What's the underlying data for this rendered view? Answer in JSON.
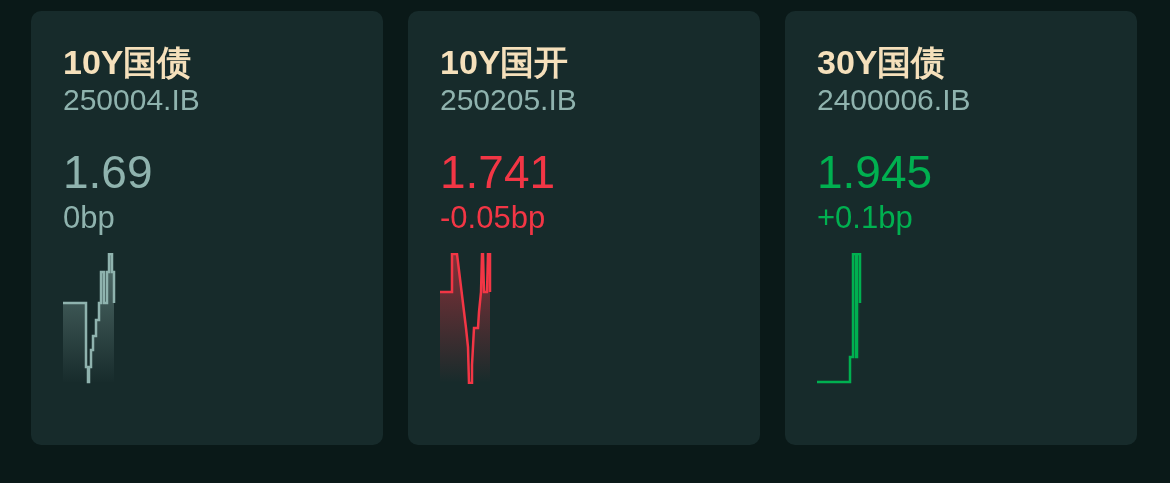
{
  "quotes": [
    {
      "name": "10Y国债",
      "code": "250004.IB",
      "yield": "1.69",
      "change": "0bp",
      "color": "#8fb3ae"
    },
    {
      "name": "10Y国开",
      "code": "250205.IB",
      "yield": "1.741",
      "change": "-0.05bp",
      "color": "#f23645"
    },
    {
      "name": "30Y国债",
      "code": "2400006.IB",
      "yield": "1.945",
      "change": "+0.1bp",
      "color": "#00b050"
    }
  ]
}
